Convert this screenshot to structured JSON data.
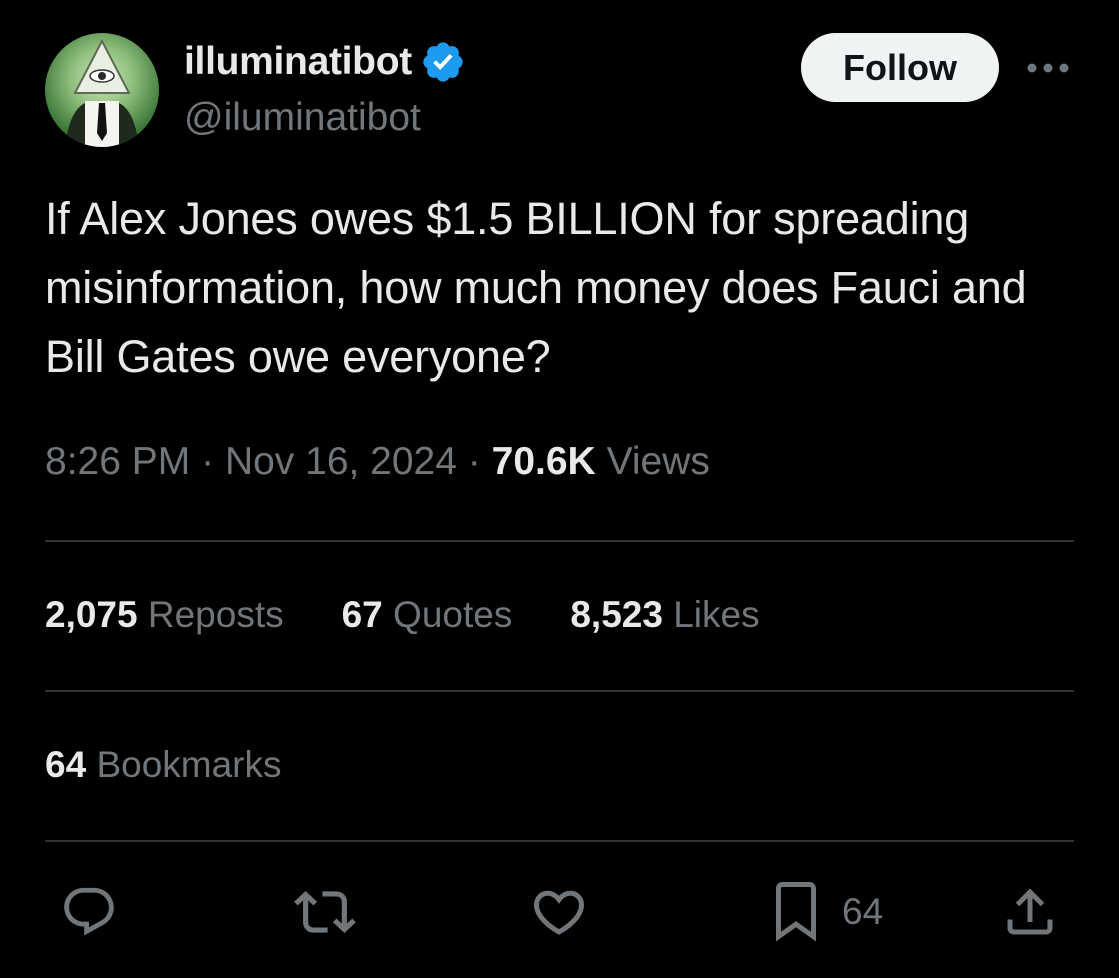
{
  "author": {
    "display_name": "illuminatibot",
    "handle": "@iluminatibot",
    "verified": true,
    "avatar_icon": "avatar-illuminati-eye-icon"
  },
  "header": {
    "follow_label": "Follow",
    "more_icon": "more-horizontal-icon"
  },
  "tweet": {
    "text": "If Alex Jones owes $1.5 BILLION for spreading misinformation, how much money does Fauci and Bill Gates owe everyone?",
    "time": "8:26 PM",
    "date": "Nov 16, 2024",
    "views_count": "70.6K",
    "views_label": "Views",
    "separator": "·"
  },
  "stats": {
    "reposts_count": "2,075",
    "reposts_label": "Reposts",
    "quotes_count": "67",
    "quotes_label": "Quotes",
    "likes_count": "8,523",
    "likes_label": "Likes",
    "bookmarks_count": "64",
    "bookmarks_label": "Bookmarks"
  },
  "actions": {
    "reply_icon": "reply-icon",
    "repost_icon": "repost-icon",
    "like_icon": "heart-icon",
    "bookmark_icon": "bookmark-icon",
    "bookmark_count": "64",
    "share_icon": "share-icon"
  },
  "colors": {
    "background": "#000000",
    "primary_text": "#e7e9ea",
    "secondary_text": "#71767b",
    "divider": "#2f3336",
    "verified_blue": "#1d9bf0",
    "follow_bg": "#eff3f4"
  }
}
